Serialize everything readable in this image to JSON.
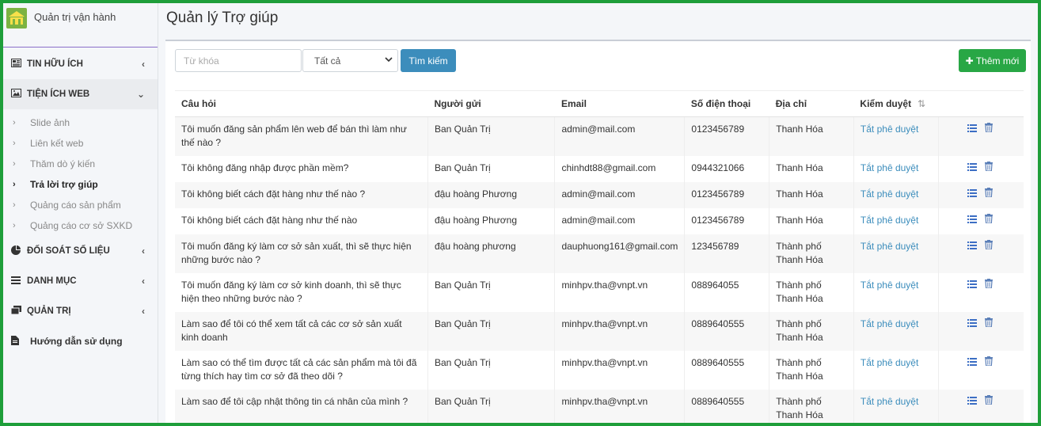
{
  "app": {
    "name": "Quản trị vận hành"
  },
  "sidebar": {
    "sections": [
      {
        "label": "TIN HỮU ÍCH",
        "icon": "newspaper-icon"
      },
      {
        "label": "TIỆN ÍCH WEB",
        "icon": "image-icon"
      },
      {
        "label": "ĐỐI SOÁT SỐ LIỆU",
        "icon": "pie-chart-icon"
      },
      {
        "label": "DANH MỤC",
        "icon": "list-icon"
      },
      {
        "label": "QUẢN TRỊ",
        "icon": "window-icon"
      }
    ],
    "web_items": [
      {
        "label": "Slide ảnh"
      },
      {
        "label": "Liên kết web"
      },
      {
        "label": "Thăm dò ý kiến"
      },
      {
        "label": "Trả lời trợ giúp"
      },
      {
        "label": "Quảng cáo sản phẩm"
      },
      {
        "label": "Quảng cáo cơ sở SXKD"
      }
    ],
    "guide": {
      "label": "Hướng dẫn sử dụng"
    }
  },
  "page": {
    "title": "Quản lý Trợ giúp"
  },
  "toolbar": {
    "keyword_placeholder": "Từ khóa",
    "filter_value": "Tất cả",
    "search_label": "Tìm kiếm",
    "add_label": "Thêm mới"
  },
  "table": {
    "headers": {
      "question": "Câu hỏi",
      "sender": "Người gửi",
      "email": "Email",
      "phone": "Số điện thoại",
      "address": "Địa chỉ",
      "review": "Kiểm duyệt"
    },
    "rows": [
      {
        "question": "Tôi muốn đăng sản phẩm lên web để bán thì làm như thế nào ?",
        "sender": "Ban Quản Trị",
        "email": "admin@mail.com",
        "phone": "0123456789",
        "address": "Thanh Hóa",
        "review": "Tắt phê duyệt"
      },
      {
        "question": "Tôi không đăng nhập được phần mềm?",
        "sender": "Ban Quản Trị",
        "email": "chinhdt88@gmail.com",
        "phone": "0944321066",
        "address": "Thanh Hóa",
        "review": "Tắt phê duyệt"
      },
      {
        "question": "Tôi không biết cách đặt hàng như thế nào ?",
        "sender": "đậu hoàng Phương",
        "email": "admin@mail.com",
        "phone": "0123456789",
        "address": "Thanh Hóa",
        "review": "Tắt phê duyệt"
      },
      {
        "question": "Tôi không biết cách đặt hàng như thế nào",
        "sender": "đậu hoàng Phương",
        "email": "admin@mail.com",
        "phone": "0123456789",
        "address": "Thanh Hóa",
        "review": "Tắt phê duyệt"
      },
      {
        "question": "Tôi muốn đăng ký làm cơ sở sản xuất, thì sẽ thực hiện những bước nào ?",
        "sender": "đậu hoàng phương",
        "email": "dauphuong161@gmail.com",
        "phone": "123456789",
        "address": "Thành phố Thanh Hóa",
        "review": "Tắt phê duyệt"
      },
      {
        "question": "Tôi muốn đăng ký làm cơ sở kinh doanh, thì sẽ thực hiện theo những bước nào ?",
        "sender": "Ban Quản Trị",
        "email": "minhpv.tha@vnpt.vn",
        "phone": "088964055",
        "address": "Thành phố Thanh Hóa",
        "review": "Tắt phê duyệt"
      },
      {
        "question": "Làm sao để tôi có thể xem tất cả các cơ sở sản xuất kinh doanh",
        "sender": "Ban Quản Trị",
        "email": "minhpv.tha@vnpt.vn",
        "phone": "0889640555",
        "address": "Thành phố Thanh Hóa",
        "review": "Tắt phê duyệt"
      },
      {
        "question": "Làm sao có thể tìm được tất cả các sản phẩm mà tôi đã từng thích hay tìm cơ sở đã theo dõi ?",
        "sender": "Ban Quản Trị",
        "email": "minhpv.tha@vnpt.vn",
        "phone": "0889640555",
        "address": "Thành phố Thanh Hóa",
        "review": "Tắt phê duyệt"
      },
      {
        "question": "Làm sao để tôi cập nhật thông tin cá nhân của mình ?",
        "sender": "Ban Quản Trị",
        "email": "minhpv.tha@vnpt.vn",
        "phone": "0889640555",
        "address": "Thành phố Thanh Hóa",
        "review": "Tắt phê duyệt"
      }
    ]
  }
}
